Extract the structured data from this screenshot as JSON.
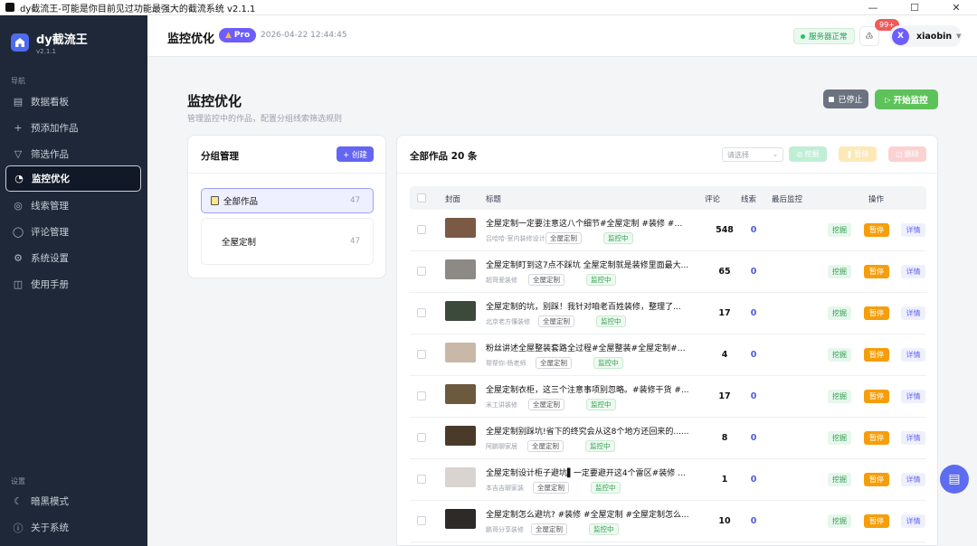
{
  "window": {
    "title": "dy截流王-可能是你目前见过功能最强大的截流系统 v2.1.1"
  },
  "brand": {
    "name": "dy截流王",
    "version": "v2.1.1"
  },
  "sidebar": {
    "nav_header": "导航",
    "items": [
      {
        "label": "数据看板",
        "icon": "dashboard-icon"
      },
      {
        "label": "预添加作品",
        "icon": "plus-icon"
      },
      {
        "label": "筛选作品",
        "icon": "filter-icon"
      },
      {
        "label": "监控优化",
        "icon": "monitor-icon",
        "active": true
      },
      {
        "label": "线索管理",
        "icon": "target-icon"
      },
      {
        "label": "评论管理",
        "icon": "comment-icon"
      },
      {
        "label": "系统设置",
        "icon": "gear-icon"
      },
      {
        "label": "使用手册",
        "icon": "book-icon"
      }
    ],
    "settings_header": "设置",
    "settings_items": [
      {
        "label": "暗黑模式",
        "icon": "moon-icon"
      },
      {
        "label": "关于系统",
        "icon": "info-icon"
      }
    ]
  },
  "header": {
    "title": "监控优化",
    "pro": "Pro",
    "datetime": "2026-04-22 12:44:45",
    "service_status": "服务器正常",
    "notif_badge": "99+",
    "user_initial": "X",
    "username": "xiaobin"
  },
  "page": {
    "title": "监控优化",
    "subtitle": "管理监控中的作品，配置分组线索筛选规则",
    "stop_label": "已停止",
    "start_label": "开始监控"
  },
  "groups": {
    "title": "分组管理",
    "create_label": "+ 创建",
    "items": [
      {
        "name": "全部作品",
        "count": "47"
      },
      {
        "name": "全屋定制",
        "count": "47"
      }
    ]
  },
  "works": {
    "title": "全部作品 20 条",
    "select_placeholder": "请选择",
    "batch_dig": "挖掘",
    "batch_pause": "暂停",
    "batch_delete": "删除",
    "columns": {
      "cover": "封面",
      "title": "标题",
      "comments": "评论",
      "clues": "线索",
      "last_monitor": "最后监控",
      "actions": "操作"
    },
    "action_labels": {
      "dig": "挖掘",
      "pause": "暂停",
      "detail": "详情"
    },
    "rows": [
      {
        "title": "全屋定制一定要注意这八个细节#全屋定制 #装修 #装...",
        "author": "吕哈哈-室内装修设计",
        "tag": "全屋定制",
        "status": "监控中",
        "comments": "548",
        "clues": "0"
      },
      {
        "title": "全屋定制盯到这7点不踩坑 全屋定制就是装修里面最大...",
        "author": "超哥爱装修",
        "tag": "全屋定制",
        "status": "监控中",
        "comments": "65",
        "clues": "0"
      },
      {
        "title": "全屋定制的坑，别踩！我针对咱老百姓装修，整理了...",
        "author": "北京老方懂装修",
        "tag": "全屋定制",
        "status": "监控中",
        "comments": "17",
        "clues": "0"
      },
      {
        "title": "粉丝讲述全屋整装套路全过程#全屋整装#全屋定制#家...",
        "author": "帮帮你-杨老师",
        "tag": "全屋定制",
        "status": "监控中",
        "comments": "4",
        "clues": "0"
      },
      {
        "title": "全屋定制衣柜，这三个注意事项别忽略。#装修干货 #...",
        "author": "米工讲装修",
        "tag": "全屋定制",
        "status": "监控中",
        "comments": "17",
        "clues": "0"
      },
      {
        "title": "全屋定制别踩坑!省下的终究会从这8个地方还回来的......",
        "author": "阿鹏聊家居",
        "tag": "全屋定制",
        "status": "监控中",
        "comments": "8",
        "clues": "0"
      },
      {
        "title": "全屋定制设计柜子避坑▌一定要避开这4个雷区#装修 #...",
        "author": "本吉吉聊家装",
        "tag": "全屋定制",
        "status": "监控中",
        "comments": "1",
        "clues": "0"
      },
      {
        "title": "全屋定制怎么避坑? #装修 #全屋定制 #全屋定制怎么...",
        "author": "鹏哥分享装修",
        "tag": "全屋定制",
        "status": "监控中",
        "comments": "10",
        "clues": "0"
      }
    ]
  },
  "colors": {
    "sidebar_bg": "#1e2838",
    "accent": "#6366f1",
    "success": "#5ec25a",
    "warning": "#f59e0b"
  }
}
